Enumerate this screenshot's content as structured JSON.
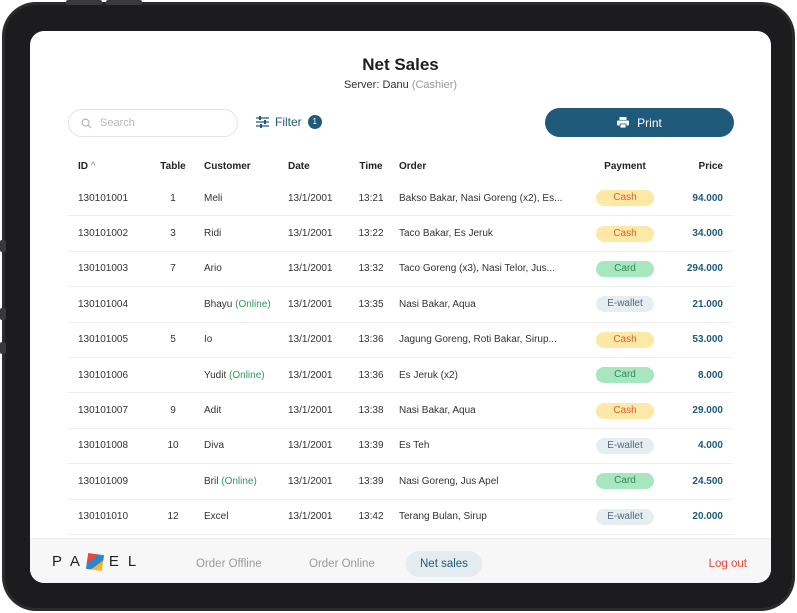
{
  "header": {
    "title": "Net Sales",
    "server_label": "Server: Danu",
    "server_role": "(Cashier)"
  },
  "toolbar": {
    "search_placeholder": "Search",
    "filter_label": "Filter",
    "filter_count": "1",
    "print_label": "Print"
  },
  "table": {
    "columns": {
      "id": "ID",
      "table": "Table",
      "customer": "Customer",
      "date": "Date",
      "time": "Time",
      "order": "Order",
      "payment": "Payment",
      "price": "Price"
    },
    "rows": [
      {
        "id": "130101001",
        "table": "1",
        "customer": "Meli",
        "online": "",
        "date": "13/1/2001",
        "time": "13:21",
        "order": "Bakso Bakar, Nasi Goreng (x2), Es...",
        "payment": "Cash",
        "price": "94.000"
      },
      {
        "id": "130101002",
        "table": "3",
        "customer": "Ridi",
        "online": "",
        "date": "13/1/2001",
        "time": "13:22",
        "order": "Taco Bakar, Es Jeruk",
        "payment": "Cash",
        "price": "34.000"
      },
      {
        "id": "130101003",
        "table": "7",
        "customer": "Ario",
        "online": "",
        "date": "13/1/2001",
        "time": "13:32",
        "order": "Taco Goreng (x3), Nasi Telor, Jus...",
        "payment": "Card",
        "price": "294.000"
      },
      {
        "id": "130101004",
        "table": "",
        "customer": "Bhayu",
        "online": "(Online)",
        "date": "13/1/2001",
        "time": "13:35",
        "order": "Nasi Bakar, Aqua",
        "payment": "E-wallet",
        "price": "21.000"
      },
      {
        "id": "130101005",
        "table": "5",
        "customer": "Io",
        "online": "",
        "date": "13/1/2001",
        "time": "13:36",
        "order": "Jagung Goreng, Roti Bakar, Sirup...",
        "payment": "Cash",
        "price": "53.000"
      },
      {
        "id": "130101006",
        "table": "",
        "customer": "Yudit",
        "online": "(Online)",
        "date": "13/1/2001",
        "time": "13:36",
        "order": "Es Jeruk (x2)",
        "payment": "Card",
        "price": "8.000"
      },
      {
        "id": "130101007",
        "table": "9",
        "customer": "Adit",
        "online": "",
        "date": "13/1/2001",
        "time": "13:38",
        "order": "Nasi Bakar, Aqua",
        "payment": "Cash",
        "price": "29.000"
      },
      {
        "id": "130101008",
        "table": "10",
        "customer": "Diva",
        "online": "",
        "date": "13/1/2001",
        "time": "13:39",
        "order": "Es Teh",
        "payment": "E-wallet",
        "price": "4.000"
      },
      {
        "id": "130101009",
        "table": "",
        "customer": "Bril",
        "online": "(Online)",
        "date": "13/1/2001",
        "time": "13:39",
        "order": "Nasi Goreng, Jus Apel",
        "payment": "Card",
        "price": "24.500"
      },
      {
        "id": "130101010",
        "table": "12",
        "customer": "Excel",
        "online": "",
        "date": "13/1/2001",
        "time": "13:42",
        "order": "Terang Bulan, Sirup",
        "payment": "E-wallet",
        "price": "20.000"
      }
    ]
  },
  "footer": {
    "logo_left": "PA",
    "logo_right": "EL",
    "nav": [
      {
        "label": "Order Offline"
      },
      {
        "label": "Order Online"
      },
      {
        "label": "Net sales"
      }
    ],
    "active_nav": "Net sales",
    "logout_label": "Log out"
  },
  "colors": {
    "primary": "#1f5a7a",
    "cash_bg": "#fde8a6",
    "card_bg": "#a8e6bf",
    "ewallet_bg": "#e6eef2",
    "logout": "#e04a3a"
  }
}
